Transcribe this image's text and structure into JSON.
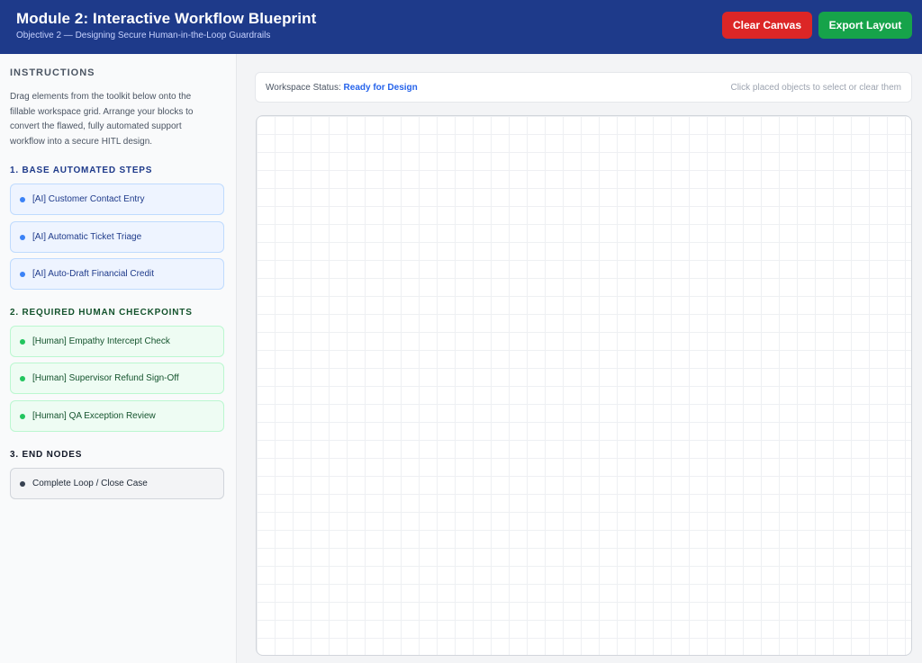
{
  "header": {
    "title": "Module 2: Interactive Workflow Blueprint",
    "subtitle": "Objective 2 — Designing Secure Human-in-the-Loop Guardrails",
    "clear_label": "Clear Canvas",
    "export_label": "Export Layout"
  },
  "sidebar": {
    "instructions_title": "INSTRUCTIONS",
    "instructions_text": "Drag elements from the toolkit below onto the fillable workspace grid. Arrange your blocks to convert the flawed, fully automated support workflow into a secure HITL design.",
    "sections": [
      {
        "title": "1. BASE AUTOMATED STEPS",
        "items": [
          "[AI] Customer Contact Entry",
          "[AI] Automatic Ticket Triage",
          "[AI] Auto-Draft Financial Credit"
        ]
      },
      {
        "title": "2. REQUIRED HUMAN CHECKPOINTS",
        "items": [
          "[Human] Empathy Intercept Check",
          "[Human] Supervisor Refund Sign-Off",
          "[Human] QA Exception Review"
        ]
      },
      {
        "title": "3. END NODES",
        "items": [
          "Complete Loop / Close Case"
        ]
      }
    ]
  },
  "status": {
    "label": "Workspace Status:",
    "value": "Ready for Design",
    "hint": "Click placed objects to select or clear them"
  },
  "colors": {
    "header_bg": "#1e3a8a",
    "clear_button": "#dc2626",
    "export_button": "#16a34a",
    "ai_accent": "#3b82f6",
    "human_accent": "#22c55e",
    "end_accent": "#374151",
    "status_value": "#2563eb"
  }
}
